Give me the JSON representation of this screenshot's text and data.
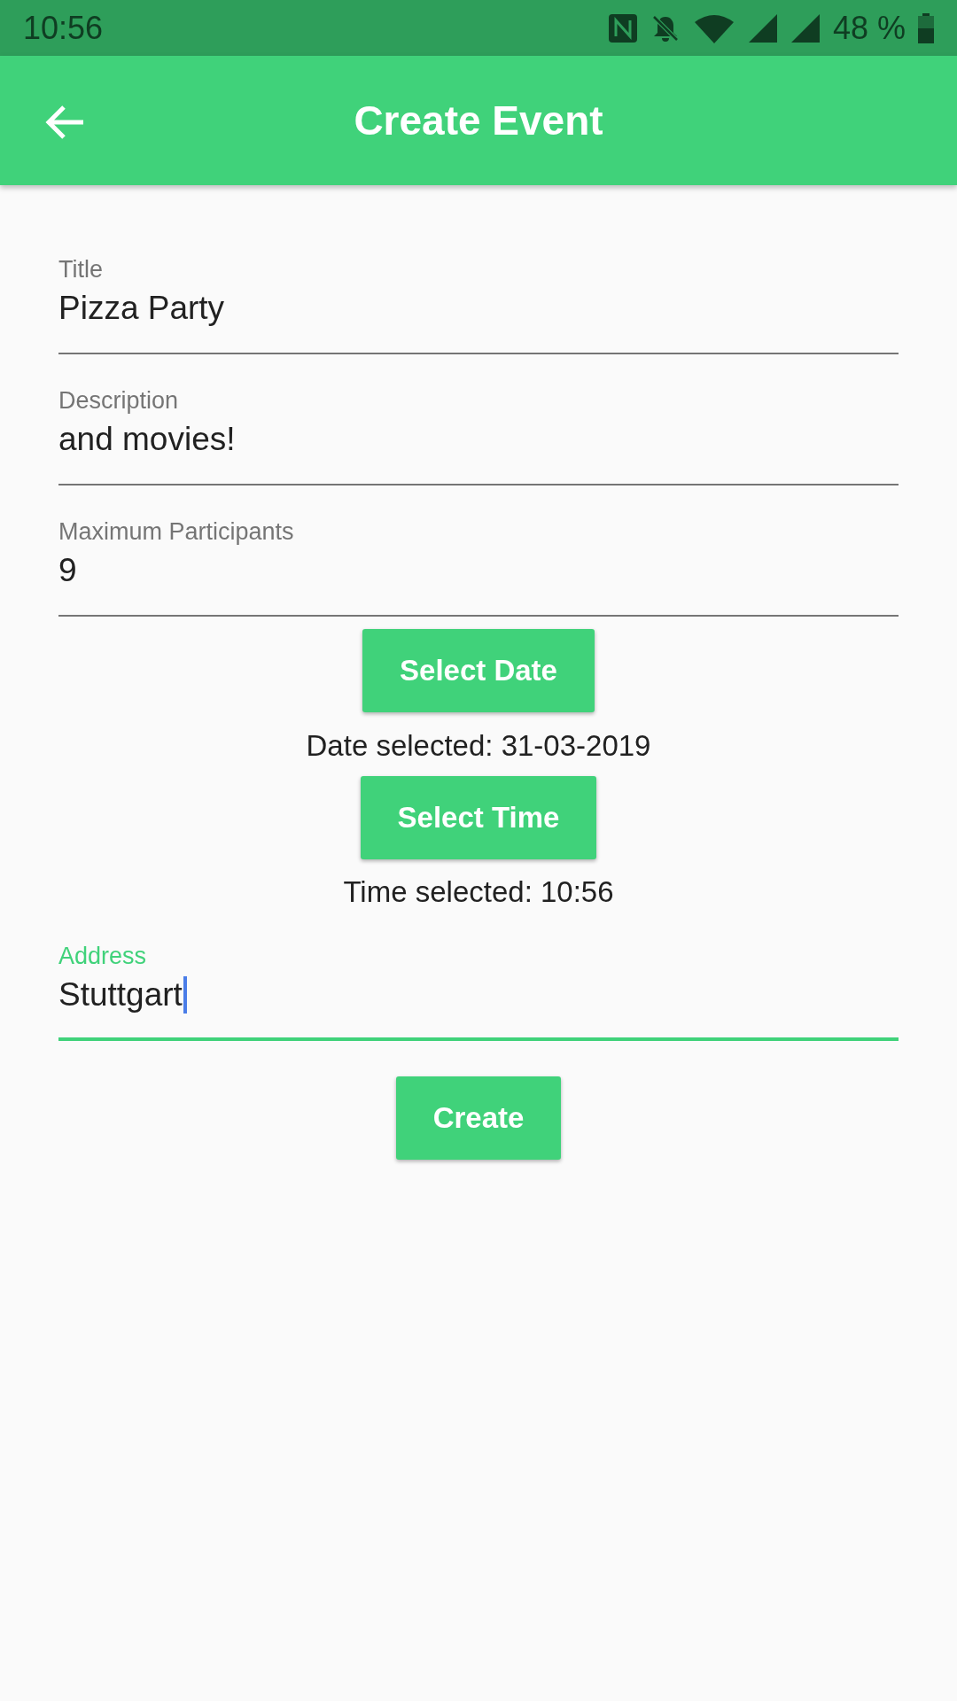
{
  "status_bar": {
    "time": "10:56",
    "battery": "48 %"
  },
  "app_bar": {
    "title": "Create Event"
  },
  "fields": [
    {
      "label": "Title",
      "value": "Pizza Party",
      "focused": false
    },
    {
      "label": "Description",
      "value": "and movies!",
      "focused": false
    },
    {
      "label": "Maximum Participants",
      "value": "9",
      "focused": false
    }
  ],
  "date_button": "Select Date",
  "date_text": "Date selected: 31-03-2019",
  "time_button": "Select Time",
  "time_text": "Time selected: 10:56",
  "address_field": {
    "label": "Address",
    "value": "Stuttgart",
    "focused": true
  },
  "create_button": "Create"
}
